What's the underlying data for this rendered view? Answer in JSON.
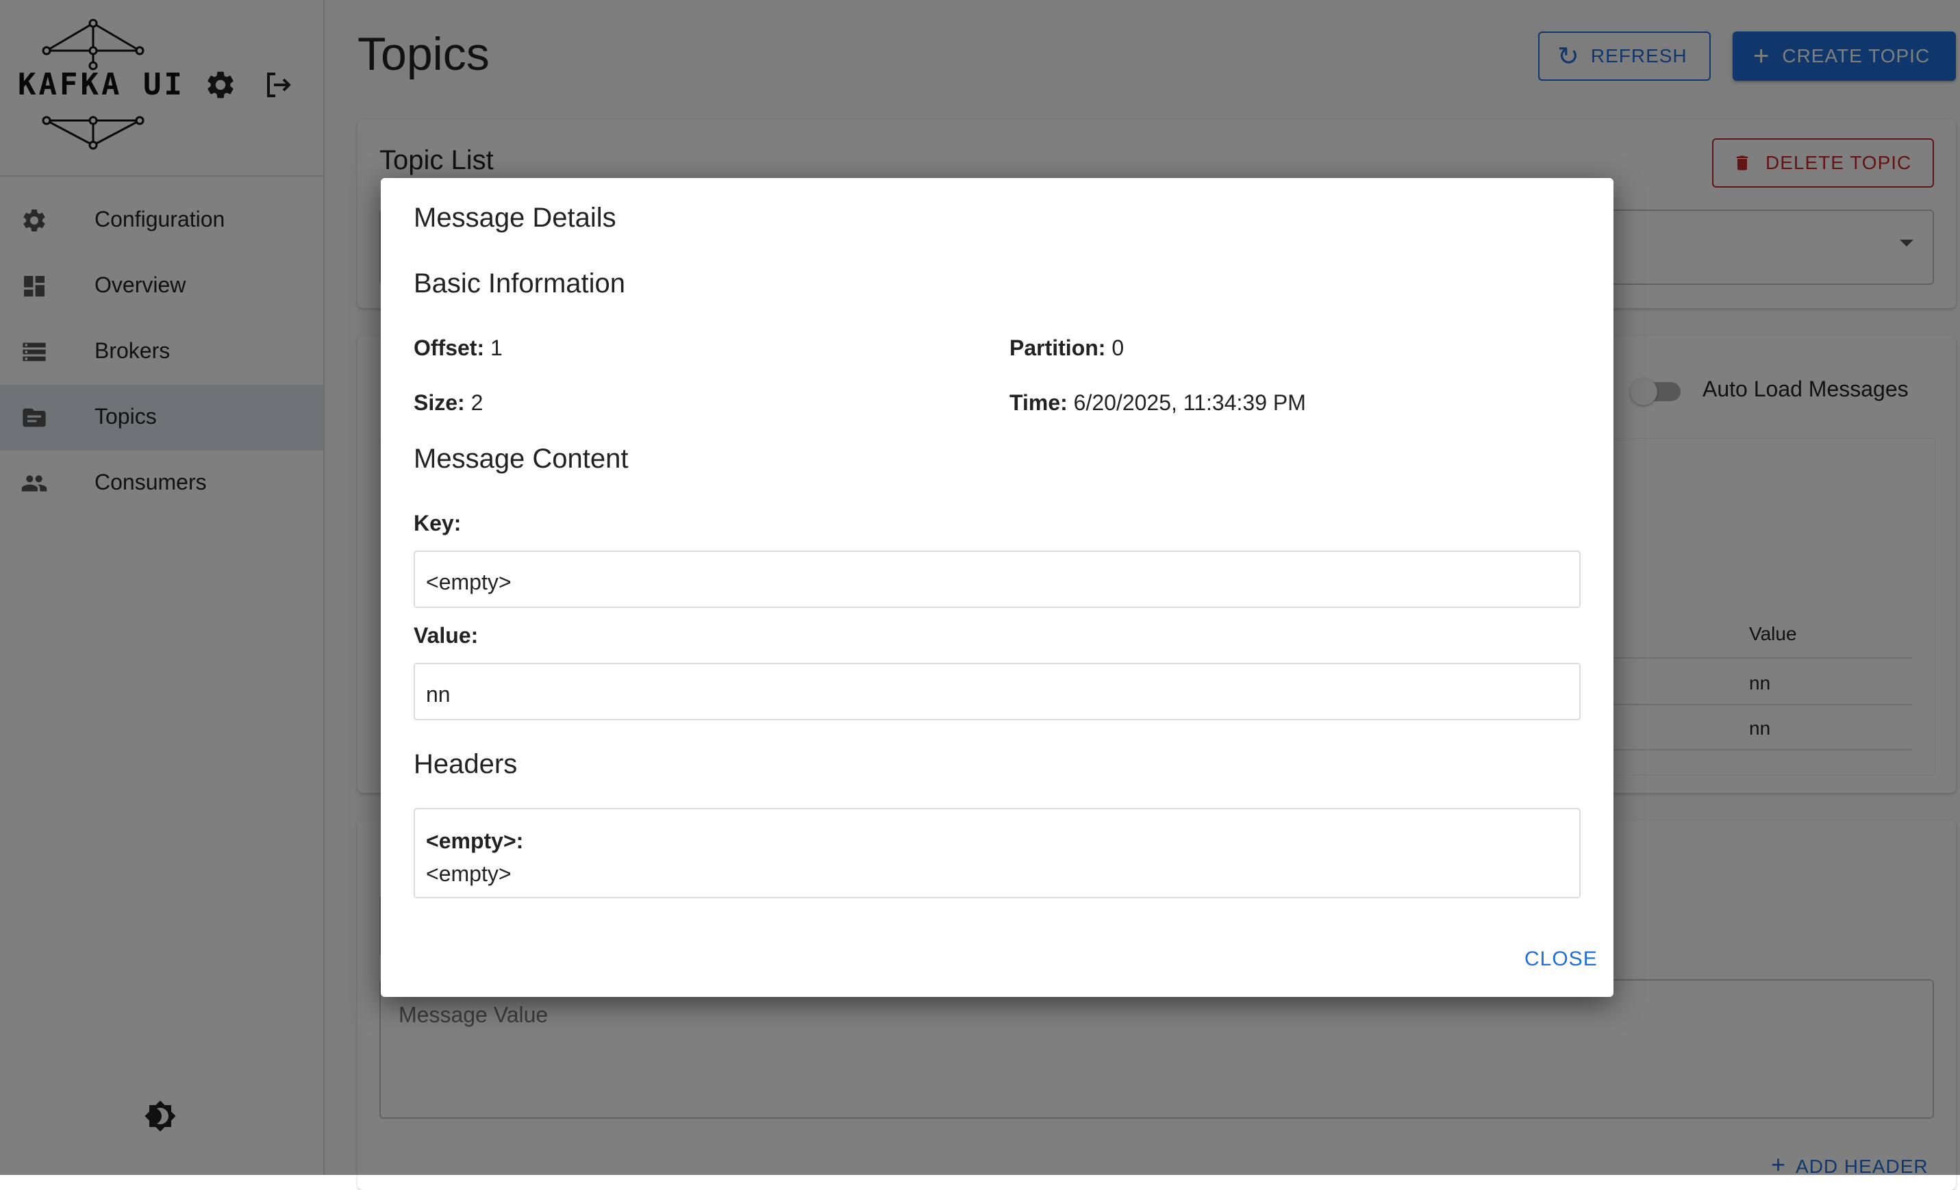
{
  "app": {
    "logo_text": "KAFKA UI"
  },
  "sidebar": {
    "items": [
      {
        "label": "Configuration",
        "icon": "gear-icon"
      },
      {
        "label": "Overview",
        "icon": "dashboard-icon"
      },
      {
        "label": "Brokers",
        "icon": "storage-icon"
      },
      {
        "label": "Topics",
        "icon": "topic-icon",
        "active": true
      },
      {
        "label": "Consumers",
        "icon": "people-icon"
      }
    ]
  },
  "header": {
    "title": "Topics",
    "refresh_label": "REFRESH",
    "create_label": "CREATE TOPIC"
  },
  "topic_list": {
    "title": "Topic List",
    "delete_label": "DELETE TOPIC"
  },
  "messages": {
    "auto_load_label": "Auto Load Messages",
    "column_value": "Value",
    "rows": [
      {
        "value": "nn"
      },
      {
        "value": "nn"
      }
    ]
  },
  "produce": {
    "value_placeholder": "Message Value",
    "add_header_label": "ADD HEADER"
  },
  "modal": {
    "title": "Message Details",
    "basic_title": "Basic Information",
    "offset_label": "Offset:",
    "offset_value": "1",
    "partition_label": "Partition:",
    "partition_value": "0",
    "size_label": "Size:",
    "size_value": "2",
    "time_label": "Time:",
    "time_value": "6/20/2025, 11:34:39 PM",
    "content_title": "Message Content",
    "key_label": "Key:",
    "key_value": "<empty>",
    "value_label": "Value:",
    "value_value": "nn",
    "headers_title": "Headers",
    "header_key": "<empty>:",
    "header_value": "<empty>",
    "close_label": "CLOSE"
  },
  "colors": {
    "primary": "#1e6fd9",
    "danger": "#c62828",
    "active_nav": "#dfe7f0"
  }
}
